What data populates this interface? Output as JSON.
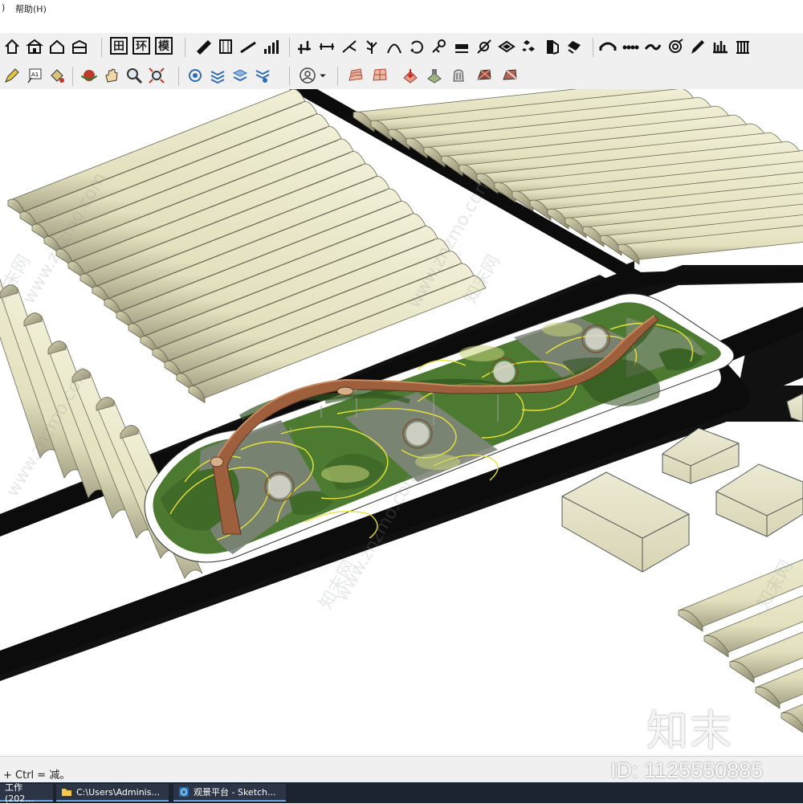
{
  "menubar": {
    "items": [
      {
        "label": ")"
      },
      {
        "label": "帮助(H)"
      }
    ]
  },
  "toolbar_row1": {
    "buttons": [
      {
        "name": "home-icon"
      },
      {
        "name": "store-icon"
      },
      {
        "name": "house-icon"
      },
      {
        "name": "warehouse-icon"
      },
      {
        "name": "plan-grid-button",
        "label": "田"
      },
      {
        "name": "environment-button",
        "label": "环"
      },
      {
        "name": "model-button",
        "label": "模"
      },
      {
        "name": "stair-icon"
      },
      {
        "name": "column-icon"
      },
      {
        "name": "ramp-icon"
      },
      {
        "name": "bar-stairs-icon"
      },
      {
        "name": "pipe-icon"
      },
      {
        "name": "dimension-icon"
      },
      {
        "name": "branch-icon"
      },
      {
        "name": "tree-icon"
      },
      {
        "name": "arch-icon"
      },
      {
        "name": "rotate-arrow-icon"
      },
      {
        "name": "node-icon"
      },
      {
        "name": "slab-icon"
      },
      {
        "name": "link-icon"
      },
      {
        "name": "tile-icon"
      },
      {
        "name": "scatter-icon"
      },
      {
        "name": "door-icon"
      },
      {
        "name": "roof-icon"
      },
      {
        "name": "bridge-arch-icon"
      },
      {
        "name": "chain-icon"
      },
      {
        "name": "curve-icon"
      },
      {
        "name": "spiral-icon"
      },
      {
        "name": "pen-icon"
      },
      {
        "name": "bars-icon"
      },
      {
        "name": "colonnade-icon"
      }
    ]
  },
  "toolbar_row2": {
    "buttons": [
      {
        "name": "pencil-icon"
      },
      {
        "name": "text-label-icon",
        "label": "A1"
      },
      {
        "name": "paint-bucket-icon"
      },
      {
        "name": "orbit-icon"
      },
      {
        "name": "pan-hand-icon"
      },
      {
        "name": "zoom-icon"
      },
      {
        "name": "zoom-extents-icon"
      },
      {
        "name": "component-icon"
      },
      {
        "name": "stack-icon"
      },
      {
        "name": "layers-icon"
      },
      {
        "name": "settings-stack-icon"
      },
      {
        "name": "user-icon"
      },
      {
        "name": "dropdown-arrow-icon"
      },
      {
        "name": "sandbox-contours-icon"
      },
      {
        "name": "sandbox-grid-icon"
      },
      {
        "name": "smoove-icon"
      },
      {
        "name": "stamp-icon"
      },
      {
        "name": "drape-icon"
      },
      {
        "name": "add-detail-icon"
      },
      {
        "name": "flip-edge-icon"
      }
    ]
  },
  "status": {
    "text": "+ Ctrl = 减。"
  },
  "taskbar": {
    "tasks": [
      {
        "label": "工作(202..."
      },
      {
        "label": "C:\\Users\\Adminis..."
      },
      {
        "label": "观景平台 - Sketch..."
      }
    ]
  },
  "watermark": {
    "brand": "知末",
    "id": "ID: 1125550885",
    "site": "www.znzmo.com",
    "site_cn": "知末网"
  },
  "colors": {
    "greenhouse": "#e6e4c4",
    "road": "#0f0f0f",
    "lawn": "#4c7a30",
    "bridge": "#9a5a3a",
    "path": "#8a8e86"
  }
}
